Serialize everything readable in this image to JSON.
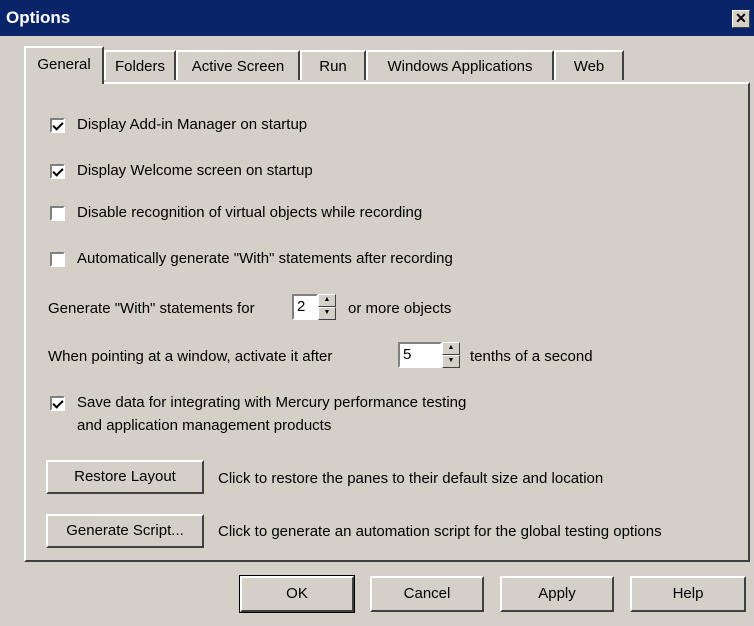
{
  "window": {
    "title": "Options",
    "close_glyph": "✕"
  },
  "tabs": [
    {
      "label": "General",
      "active": true
    },
    {
      "label": "Folders",
      "active": false
    },
    {
      "label": "Active Screen",
      "active": false
    },
    {
      "label": "Run",
      "active": false
    },
    {
      "label": "Windows Applications",
      "active": false
    },
    {
      "label": "Web",
      "active": false
    }
  ],
  "general": {
    "options": [
      {
        "label": "Display Add-in Manager on startup",
        "checked": true
      },
      {
        "label": "Display Welcome screen on startup",
        "checked": true
      },
      {
        "label": "Disable recognition of virtual objects while recording",
        "checked": false
      },
      {
        "label": "Automatically generate \"With\" statements after recording",
        "checked": false
      }
    ],
    "with_prefix": "Generate \"With\" statements for",
    "with_value": "2",
    "with_suffix": "or more objects",
    "activate_prefix": "When pointing at a window, activate it after",
    "activate_value": "5",
    "activate_suffix": "tenths of a second",
    "save_data_line1": "Save data for integrating with Mercury performance testing",
    "save_data_line2": "and application management products",
    "save_data_checked": true,
    "restore_button": "Restore Layout",
    "restore_desc": "Click to restore the panes to their default size and location",
    "generate_button": "Generate Script...",
    "generate_desc": "Click to generate an automation script for the global testing options"
  },
  "footer": {
    "ok": "OK",
    "cancel": "Cancel",
    "apply": "Apply",
    "help": "Help"
  }
}
